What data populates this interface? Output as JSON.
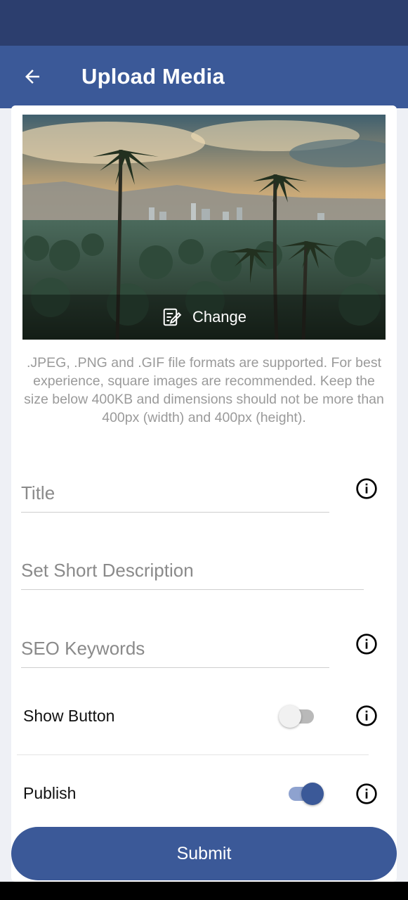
{
  "app_bar": {
    "title": "Upload Media",
    "back_icon": "arrow-left-icon"
  },
  "image": {
    "change_label": "Change",
    "change_icon": "edit-note-icon"
  },
  "hint": ".JPEG, .PNG and .GIF file formats are supported. For best experience, square images are recommended. Keep the size below 400KB and dimensions should not be more than 400px (width) and 400px (height).",
  "fields": {
    "title_placeholder": "Title",
    "description_placeholder": "Set Short Description",
    "keywords_placeholder": "SEO Keywords"
  },
  "toggles": {
    "show_button": {
      "label": "Show Button",
      "on": false
    },
    "publish": {
      "label": "Publish",
      "on": true
    }
  },
  "submit_label": "Submit",
  "colors": {
    "primary": "#3b5998",
    "status_bar": "#2c3e6e",
    "hint": "#9a9a9a"
  }
}
